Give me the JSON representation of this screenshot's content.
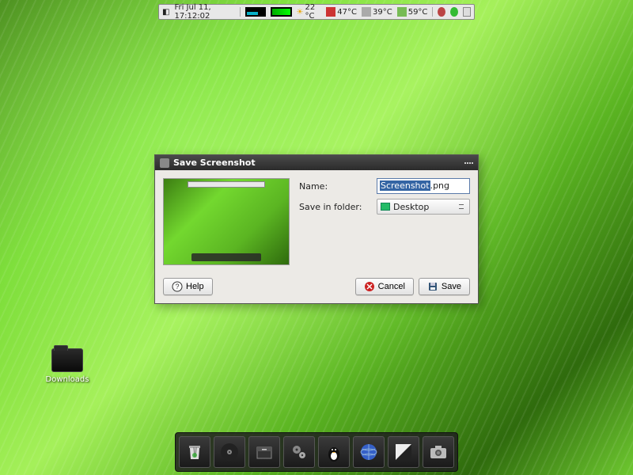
{
  "panel": {
    "datetime": "Fri Jul 11, 17:12:02",
    "temp_ambient": "22 °C",
    "temp_cpu1": "47°C",
    "temp_cpu2": "39°C",
    "temp_cpu3": "59°C"
  },
  "desktop": {
    "downloads_label": "Downloads"
  },
  "dialog": {
    "title": "Save Screenshot",
    "name_label": "Name:",
    "name_value_selected": "Screenshot",
    "name_value_ext": ".png",
    "folder_label": "Save in folder:",
    "folder_value": "Desktop",
    "help_label": "Help",
    "cancel_label": "Cancel",
    "save_label": "Save"
  },
  "dock": {
    "items": [
      "trash",
      "music-player",
      "file-manager",
      "settings",
      "media",
      "web-browser",
      "display",
      "screenshot"
    ]
  }
}
